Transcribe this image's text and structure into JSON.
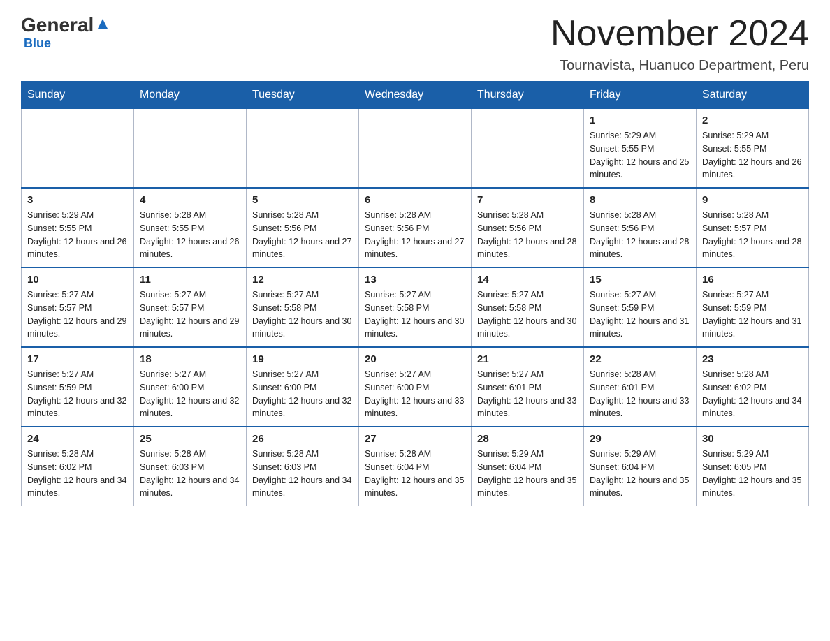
{
  "header": {
    "logo_general": "General",
    "logo_blue": "Blue",
    "main_title": "November 2024",
    "subtitle": "Tournavista, Huanuco Department, Peru"
  },
  "days_of_week": [
    "Sunday",
    "Monday",
    "Tuesday",
    "Wednesday",
    "Thursday",
    "Friday",
    "Saturday"
  ],
  "weeks": [
    [
      {
        "day": "",
        "sunrise": "",
        "sunset": "",
        "daylight": "",
        "empty": true
      },
      {
        "day": "",
        "sunrise": "",
        "sunset": "",
        "daylight": "",
        "empty": true
      },
      {
        "day": "",
        "sunrise": "",
        "sunset": "",
        "daylight": "",
        "empty": true
      },
      {
        "day": "",
        "sunrise": "",
        "sunset": "",
        "daylight": "",
        "empty": true
      },
      {
        "day": "",
        "sunrise": "",
        "sunset": "",
        "daylight": "",
        "empty": true
      },
      {
        "day": "1",
        "sunrise": "Sunrise: 5:29 AM",
        "sunset": "Sunset: 5:55 PM",
        "daylight": "Daylight: 12 hours and 25 minutes.",
        "empty": false
      },
      {
        "day": "2",
        "sunrise": "Sunrise: 5:29 AM",
        "sunset": "Sunset: 5:55 PM",
        "daylight": "Daylight: 12 hours and 26 minutes.",
        "empty": false
      }
    ],
    [
      {
        "day": "3",
        "sunrise": "Sunrise: 5:29 AM",
        "sunset": "Sunset: 5:55 PM",
        "daylight": "Daylight: 12 hours and 26 minutes.",
        "empty": false
      },
      {
        "day": "4",
        "sunrise": "Sunrise: 5:28 AM",
        "sunset": "Sunset: 5:55 PM",
        "daylight": "Daylight: 12 hours and 26 minutes.",
        "empty": false
      },
      {
        "day": "5",
        "sunrise": "Sunrise: 5:28 AM",
        "sunset": "Sunset: 5:56 PM",
        "daylight": "Daylight: 12 hours and 27 minutes.",
        "empty": false
      },
      {
        "day": "6",
        "sunrise": "Sunrise: 5:28 AM",
        "sunset": "Sunset: 5:56 PM",
        "daylight": "Daylight: 12 hours and 27 minutes.",
        "empty": false
      },
      {
        "day": "7",
        "sunrise": "Sunrise: 5:28 AM",
        "sunset": "Sunset: 5:56 PM",
        "daylight": "Daylight: 12 hours and 28 minutes.",
        "empty": false
      },
      {
        "day": "8",
        "sunrise": "Sunrise: 5:28 AM",
        "sunset": "Sunset: 5:56 PM",
        "daylight": "Daylight: 12 hours and 28 minutes.",
        "empty": false
      },
      {
        "day": "9",
        "sunrise": "Sunrise: 5:28 AM",
        "sunset": "Sunset: 5:57 PM",
        "daylight": "Daylight: 12 hours and 28 minutes.",
        "empty": false
      }
    ],
    [
      {
        "day": "10",
        "sunrise": "Sunrise: 5:27 AM",
        "sunset": "Sunset: 5:57 PM",
        "daylight": "Daylight: 12 hours and 29 minutes.",
        "empty": false
      },
      {
        "day": "11",
        "sunrise": "Sunrise: 5:27 AM",
        "sunset": "Sunset: 5:57 PM",
        "daylight": "Daylight: 12 hours and 29 minutes.",
        "empty": false
      },
      {
        "day": "12",
        "sunrise": "Sunrise: 5:27 AM",
        "sunset": "Sunset: 5:58 PM",
        "daylight": "Daylight: 12 hours and 30 minutes.",
        "empty": false
      },
      {
        "day": "13",
        "sunrise": "Sunrise: 5:27 AM",
        "sunset": "Sunset: 5:58 PM",
        "daylight": "Daylight: 12 hours and 30 minutes.",
        "empty": false
      },
      {
        "day": "14",
        "sunrise": "Sunrise: 5:27 AM",
        "sunset": "Sunset: 5:58 PM",
        "daylight": "Daylight: 12 hours and 30 minutes.",
        "empty": false
      },
      {
        "day": "15",
        "sunrise": "Sunrise: 5:27 AM",
        "sunset": "Sunset: 5:59 PM",
        "daylight": "Daylight: 12 hours and 31 minutes.",
        "empty": false
      },
      {
        "day": "16",
        "sunrise": "Sunrise: 5:27 AM",
        "sunset": "Sunset: 5:59 PM",
        "daylight": "Daylight: 12 hours and 31 minutes.",
        "empty": false
      }
    ],
    [
      {
        "day": "17",
        "sunrise": "Sunrise: 5:27 AM",
        "sunset": "Sunset: 5:59 PM",
        "daylight": "Daylight: 12 hours and 32 minutes.",
        "empty": false
      },
      {
        "day": "18",
        "sunrise": "Sunrise: 5:27 AM",
        "sunset": "Sunset: 6:00 PM",
        "daylight": "Daylight: 12 hours and 32 minutes.",
        "empty": false
      },
      {
        "day": "19",
        "sunrise": "Sunrise: 5:27 AM",
        "sunset": "Sunset: 6:00 PM",
        "daylight": "Daylight: 12 hours and 32 minutes.",
        "empty": false
      },
      {
        "day": "20",
        "sunrise": "Sunrise: 5:27 AM",
        "sunset": "Sunset: 6:00 PM",
        "daylight": "Daylight: 12 hours and 33 minutes.",
        "empty": false
      },
      {
        "day": "21",
        "sunrise": "Sunrise: 5:27 AM",
        "sunset": "Sunset: 6:01 PM",
        "daylight": "Daylight: 12 hours and 33 minutes.",
        "empty": false
      },
      {
        "day": "22",
        "sunrise": "Sunrise: 5:28 AM",
        "sunset": "Sunset: 6:01 PM",
        "daylight": "Daylight: 12 hours and 33 minutes.",
        "empty": false
      },
      {
        "day": "23",
        "sunrise": "Sunrise: 5:28 AM",
        "sunset": "Sunset: 6:02 PM",
        "daylight": "Daylight: 12 hours and 34 minutes.",
        "empty": false
      }
    ],
    [
      {
        "day": "24",
        "sunrise": "Sunrise: 5:28 AM",
        "sunset": "Sunset: 6:02 PM",
        "daylight": "Daylight: 12 hours and 34 minutes.",
        "empty": false
      },
      {
        "day": "25",
        "sunrise": "Sunrise: 5:28 AM",
        "sunset": "Sunset: 6:03 PM",
        "daylight": "Daylight: 12 hours and 34 minutes.",
        "empty": false
      },
      {
        "day": "26",
        "sunrise": "Sunrise: 5:28 AM",
        "sunset": "Sunset: 6:03 PM",
        "daylight": "Daylight: 12 hours and 34 minutes.",
        "empty": false
      },
      {
        "day": "27",
        "sunrise": "Sunrise: 5:28 AM",
        "sunset": "Sunset: 6:04 PM",
        "daylight": "Daylight: 12 hours and 35 minutes.",
        "empty": false
      },
      {
        "day": "28",
        "sunrise": "Sunrise: 5:29 AM",
        "sunset": "Sunset: 6:04 PM",
        "daylight": "Daylight: 12 hours and 35 minutes.",
        "empty": false
      },
      {
        "day": "29",
        "sunrise": "Sunrise: 5:29 AM",
        "sunset": "Sunset: 6:04 PM",
        "daylight": "Daylight: 12 hours and 35 minutes.",
        "empty": false
      },
      {
        "day": "30",
        "sunrise": "Sunrise: 5:29 AM",
        "sunset": "Sunset: 6:05 PM",
        "daylight": "Daylight: 12 hours and 35 minutes.",
        "empty": false
      }
    ]
  ]
}
